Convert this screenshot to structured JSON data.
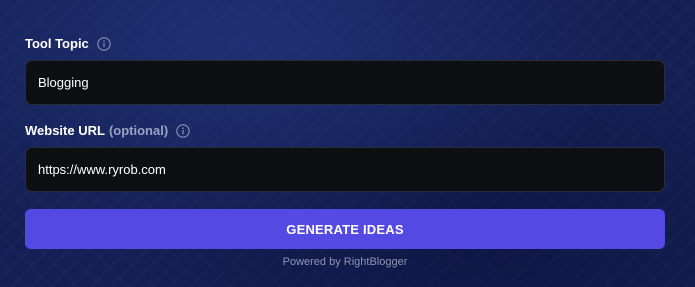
{
  "tool_topic": {
    "label": "Tool Topic",
    "icon": "info-icon",
    "value": "Blogging"
  },
  "website_url": {
    "label": "Website URL",
    "optional_label": "(optional)",
    "icon": "info-icon",
    "value": "https://www.ryrob.com"
  },
  "generate_button": {
    "label": "GENERATE IDEAS"
  },
  "footer": {
    "powered_by": "Powered by RightBlogger"
  },
  "colors": {
    "background": "#142055",
    "field_bg": "#0e0f13",
    "button": "#5449e3"
  }
}
